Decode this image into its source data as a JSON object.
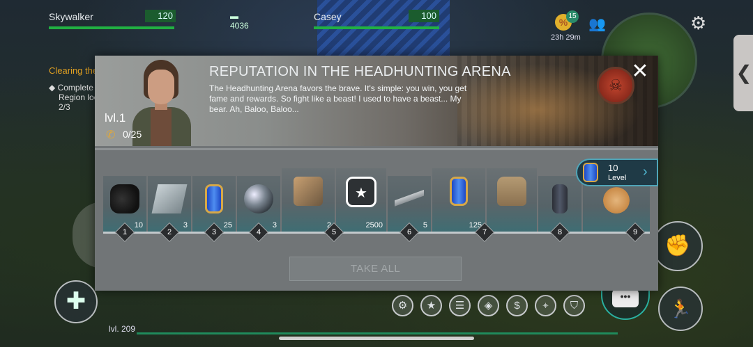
{
  "players": [
    {
      "name": "Skywalker",
      "hp": "120",
      "extra": "4036"
    },
    {
      "name": "Casey",
      "hp": "100"
    }
  ],
  "hud": {
    "badge_count": "15",
    "timer": "23h 29m",
    "quest_title": "Clearing the",
    "quest_line1": "Complete",
    "quest_line2": "Region loc",
    "quest_progress": "2/3",
    "player_level": "lvl. 209",
    "side_arrow": "❮"
  },
  "dialog": {
    "title": "REPUTATION IN THE HEADHUNTING ARENA",
    "description": "The Headhunting Arena favors the brave. It's simple: you win, you get fame and rewards. So fight like a beast! I used to have a beast... My bear. Ah, Baloo, Baloo...",
    "level": "lvl.1",
    "reputation": "0/25",
    "close": "✕",
    "take_all": "TAKE ALL"
  },
  "level_pill": {
    "value": "10",
    "label": "Level"
  },
  "rewards": [
    {
      "step": "1",
      "items": [
        {
          "icon": "coal-icon",
          "count": "10"
        }
      ]
    },
    {
      "step": "2",
      "items": [
        {
          "icon": "metal-plate-icon",
          "count": "3"
        }
      ]
    },
    {
      "step": "3",
      "items": [
        {
          "icon": "blue-canister-icon",
          "count": "25"
        }
      ]
    },
    {
      "step": "4",
      "items": [
        {
          "icon": "lens-icon",
          "count": "3"
        }
      ]
    },
    {
      "step": "5",
      "items": [
        {
          "icon": "tool-kit-icon",
          "count": "2"
        },
        {
          "icon": "medal-icon",
          "count": "2500"
        }
      ]
    },
    {
      "step": "6",
      "items": [
        {
          "icon": "metal-rod-icon",
          "count": "5"
        }
      ]
    },
    {
      "step": "7",
      "items": [
        {
          "icon": "blue-canister-icon",
          "count": "125"
        },
        {
          "icon": "backpack-icon",
          "count": ""
        }
      ]
    },
    {
      "step": "8",
      "items": [
        {
          "icon": "bottle-icon",
          "count": ""
        }
      ]
    },
    {
      "step": "9",
      "items": [
        {
          "icon": "dog-icon",
          "count": ""
        }
      ]
    }
  ]
}
